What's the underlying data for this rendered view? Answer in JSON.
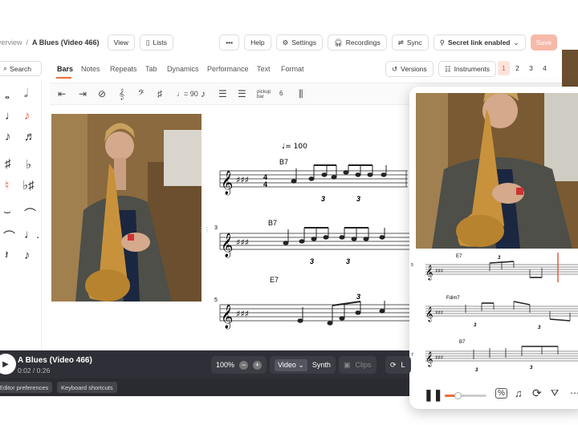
{
  "topbar": {
    "breadcrumb_overview": "Overview",
    "breadcrumb_separator": "/",
    "doc_title": "A Blues (Video 466)",
    "view_label": "View",
    "lists_label": "Lists",
    "more_label": "•••",
    "help_label": "Help",
    "settings_label": "Settings",
    "recordings_label": "Recordings",
    "sync_label": "Sync",
    "secret_link_label": "Secret link enabled",
    "save_label": "Save"
  },
  "search": {
    "label": "Search"
  },
  "tabs": [
    {
      "label": "Bars",
      "active": true
    },
    {
      "label": "Notes"
    },
    {
      "label": "Repeats"
    },
    {
      "label": "Tab"
    },
    {
      "label": "Dynamics"
    },
    {
      "label": "Performance"
    },
    {
      "label": "Text"
    },
    {
      "label": "Format"
    }
  ],
  "versions_label": "Versions",
  "instruments_label": "Instruments",
  "pages": [
    "1",
    "2",
    "3",
    "4"
  ],
  "toolbar": {
    "tempo_label": "= 90",
    "pickup_label": "pickup bar",
    "time_number": "6"
  },
  "score": {
    "tempo": "= 100",
    "systems": [
      {
        "number": "",
        "chord": "B7"
      },
      {
        "number": "3",
        "chord": "B7"
      },
      {
        "number": "5",
        "chord": "E7"
      }
    ],
    "tuplet": "3"
  },
  "popup": {
    "systems": [
      {
        "number": "5",
        "chord": "E7"
      },
      {
        "number": "6",
        "chord": "Fdim7"
      },
      {
        "number": "7",
        "chord": "B7"
      }
    ],
    "tuplet": "3"
  },
  "player": {
    "title": "A Blues (Video 466)",
    "time": "0:02 / 0:26",
    "zoom": "100%",
    "video_label": "Video",
    "synth_label": "Synth",
    "clips_label": "Clips",
    "loop_label": "L"
  },
  "footer": {
    "editor_prefs_label": "Editor preferences",
    "shortcuts_label": "Keyboard shortcuts"
  },
  "colors": {
    "accent": "#f06a3a",
    "player_bg": "#2f2f37"
  }
}
